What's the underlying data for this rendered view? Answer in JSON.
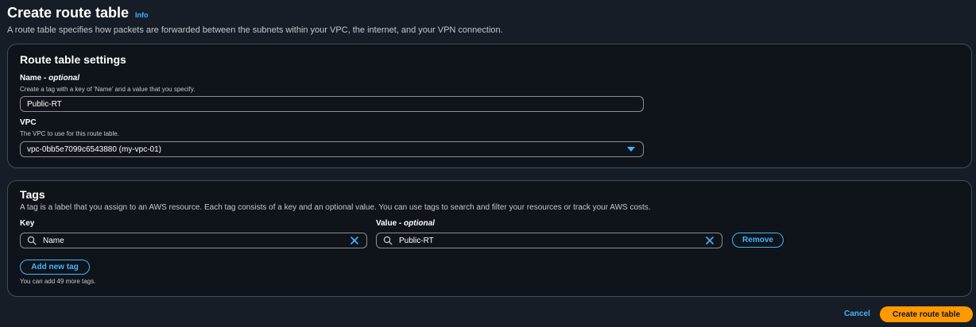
{
  "header": {
    "title": "Create route table",
    "info_label": "Info",
    "description": "A route table specifies how packets are forwarded between the subnets within your VPC, the internet, and your VPN connection."
  },
  "settings": {
    "title": "Route table settings",
    "name_label": "Name",
    "name_optional": "- optional",
    "name_hint": "Create a tag with a key of 'Name' and a value that you specify.",
    "name_value": "Public-RT",
    "vpc_label": "VPC",
    "vpc_hint": "The VPC to use for this route table.",
    "vpc_value": "vpc-0bb5e7099c6543880 (my-vpc-01)"
  },
  "tags": {
    "title": "Tags",
    "description": "A tag is a label that you assign to an AWS resource. Each tag consists of a key and an optional value. You can use tags to search and filter your resources or track your AWS costs.",
    "key_label": "Key",
    "value_label": "Value",
    "value_optional": "- optional",
    "rows": [
      {
        "key": "Name",
        "value": "Public-RT"
      }
    ],
    "remove_label": "Remove",
    "add_label": "Add new tag",
    "limit_note": "You can add 49 more tags."
  },
  "footer": {
    "cancel_label": "Cancel",
    "submit_label": "Create route table"
  },
  "colors": {
    "accent": "#42b4ff",
    "primary_button": "#ff9900",
    "background": "#161d26",
    "panel": "#0f141a"
  },
  "icons": {
    "search": "search-icon",
    "clear": "clear-icon",
    "dropdown": "caret-down-icon"
  }
}
